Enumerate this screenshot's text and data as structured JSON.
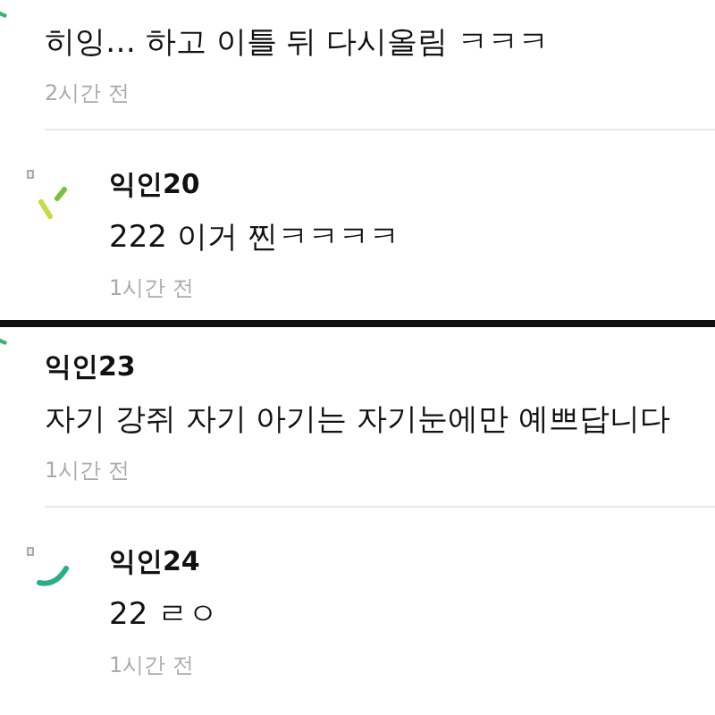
{
  "sections": [
    {
      "comments": [
        {
          "kind": "comment",
          "mark": {
            "kind": "arc"
          },
          "body": "히잉… 하고 이틀 뒤 다시올림 ㅋㅋㅋ",
          "time": "2시간 전"
        },
        {
          "kind": "reply",
          "mark": {
            "kind": "dashes"
          },
          "author": "익인20",
          "body": "222 이거 찐ㅋㅋㅋㅋ",
          "time": "1시간 전"
        }
      ]
    },
    {
      "comments": [
        {
          "kind": "comment",
          "mark": {
            "kind": "arc"
          },
          "author": "익인23",
          "body": "자기 강쥐 자기 아기는 자기눈에만 예쁘답니다",
          "time": "1시간 전"
        },
        {
          "kind": "reply",
          "mark": {
            "kind": "swoosh"
          },
          "author": "익인24",
          "body": "22 ㄹㅇ",
          "time": "1시간 전"
        }
      ]
    }
  ]
}
